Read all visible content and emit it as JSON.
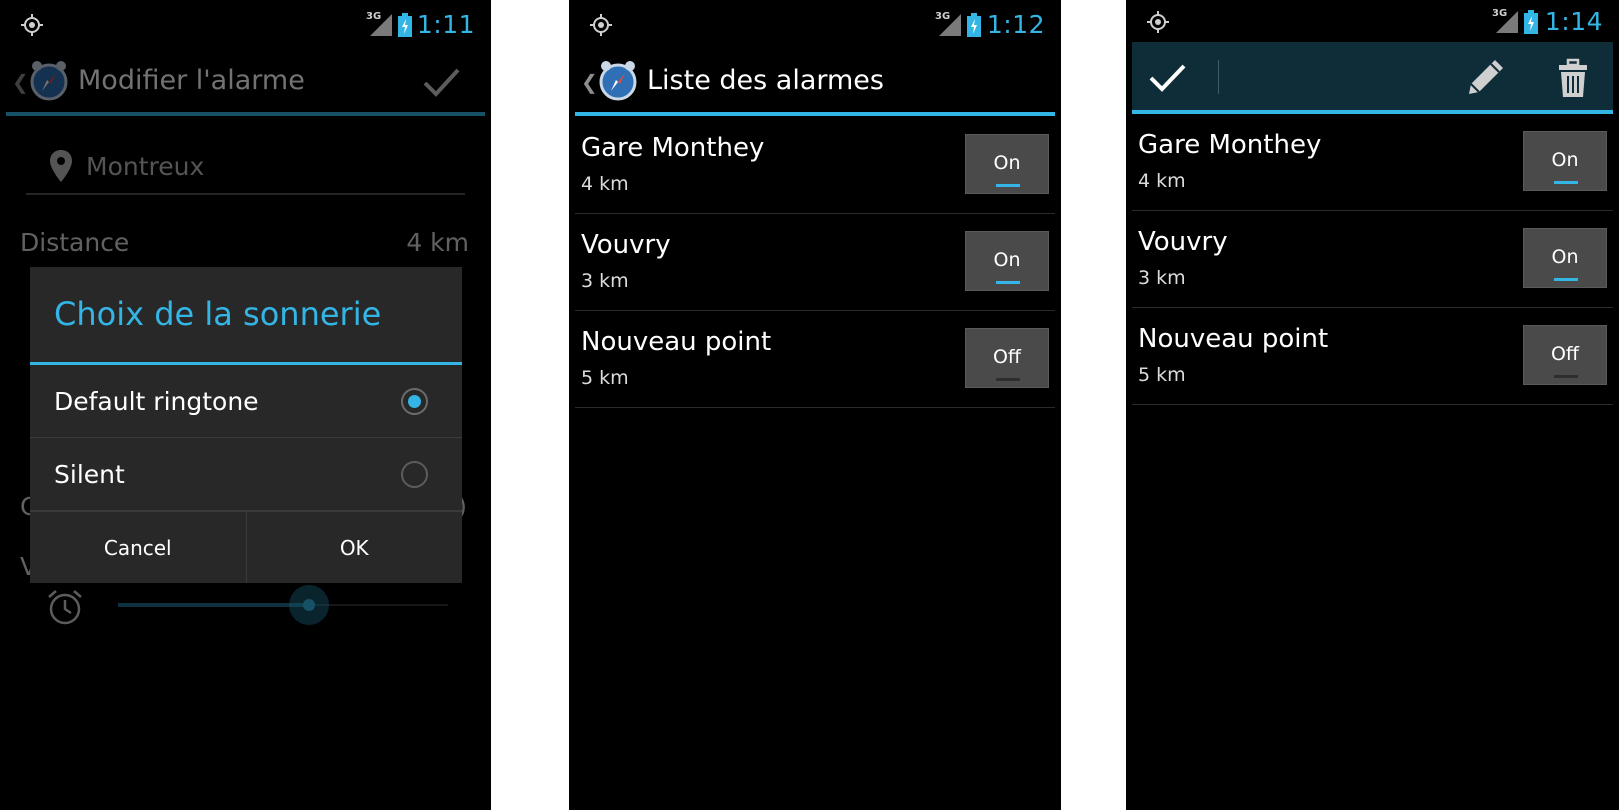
{
  "status_bar": {
    "network": "3G",
    "time_1": "1:11",
    "time_2": "1:12",
    "time_3": "1:14",
    "accent_color": "#33b5e5",
    "icons": [
      "gps-icon",
      "signal-icon",
      "battery-charging-icon"
    ]
  },
  "screen1": {
    "action_bar": {
      "title": "Modifier l'alarme",
      "back_icon": "chevron-left-icon",
      "app_icon": "alarm-clock-icon",
      "confirm_icon": "check-icon"
    },
    "form": {
      "location_value": "Montreux",
      "location_icon": "location-pin-icon",
      "distance_label": "Distance",
      "distance_value": "4 km",
      "ghost_c": "C",
      "ghost_v": "V",
      "ghost_paren": ")",
      "volume_icon": "alarm-clock-icon",
      "volume_level": 0.58
    },
    "dialog": {
      "title": "Choix de la sonnerie",
      "options": [
        {
          "label": "Default ringtone",
          "selected": true
        },
        {
          "label": "Silent",
          "selected": false
        }
      ],
      "cancel_label": "Cancel",
      "ok_label": "OK"
    }
  },
  "screen2": {
    "action_bar": {
      "title": "Liste des alarmes",
      "back_icon": "chevron-left-icon",
      "app_icon": "alarm-clock-icon"
    }
  },
  "screen3": {
    "cab": {
      "done_icon": "check-icon",
      "edit_icon": "pencil-icon",
      "delete_icon": "trash-icon",
      "background": "#0f2d38"
    }
  },
  "alarms": [
    {
      "name": "Gare Monthey",
      "distance": "4 km",
      "state": "On",
      "on": true
    },
    {
      "name": "Vouvry",
      "distance": "3 km",
      "state": "On",
      "on": true
    },
    {
      "name": "Nouveau point",
      "distance": "5 km",
      "state": "Off",
      "on": false
    }
  ]
}
